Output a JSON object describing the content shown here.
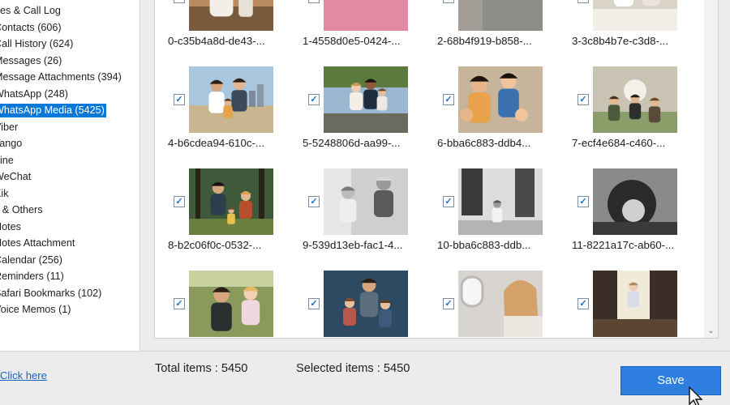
{
  "sidebar": {
    "items": [
      "ges & Call Log",
      "Contacts (606)",
      "Call History (624)",
      "Messages (26)",
      "Message Attachments (394)",
      "WhatsApp (248)",
      "WhatsApp Media (5425)",
      "Viber",
      "Tango",
      "Line",
      "WeChat",
      "Kik",
      "s & Others",
      "Notes",
      "Notes Attachment",
      "Calendar (256)",
      "Reminders (11)",
      "Safari Bookmarks (102)",
      "Voice Memos (1)"
    ],
    "selected_index": 6,
    "selected_color": "#0a78d7"
  },
  "media": {
    "checked_mark": "✓",
    "files": [
      "0-c35b4a8d-de43-...",
      "1-4558d0e5-0424-...",
      "2-68b4f919-b858-...",
      "3-3c8b4b7e-c3d8-...",
      "4-b6cdea94-610c-...",
      "5-5248806d-aa99-...",
      "6-bba6c883-ddb4...",
      "7-ecf4e684-c460-...",
      "8-b2c06f0c-0532-...",
      "9-539d13eb-fac1-4...",
      "10-bba6c883-ddb...",
      "11-8221a17c-ab60-...",
      "",
      "",
      "",
      ""
    ],
    "photo_icons": [
      "woman-holding-baby-photo",
      "kitten-photo",
      "cat-photo",
      "kids-on-bed-photo",
      "family-walking-beach-photo",
      "family-sitting-outdoors-photo",
      "kids-peace-sign-photo",
      "kids-cheering-field-photo",
      "family-walking-woods-photo",
      "grandfather-dancing-girl-photo",
      "parents-walking-child-photo",
      "curly-haired-child-photo",
      "father-daughter-selfie-photo",
      "family-portrait-photo",
      "woman-airplane-window-photo",
      "toddler-at-window-photo"
    ]
  },
  "footer": {
    "link": "Click here",
    "total": "Total items : 5450",
    "selected": "Selected items : 5450",
    "save_label": "Save"
  },
  "scroll_icon": "chevron-down-icon",
  "accent_color": "#2f7fe0"
}
